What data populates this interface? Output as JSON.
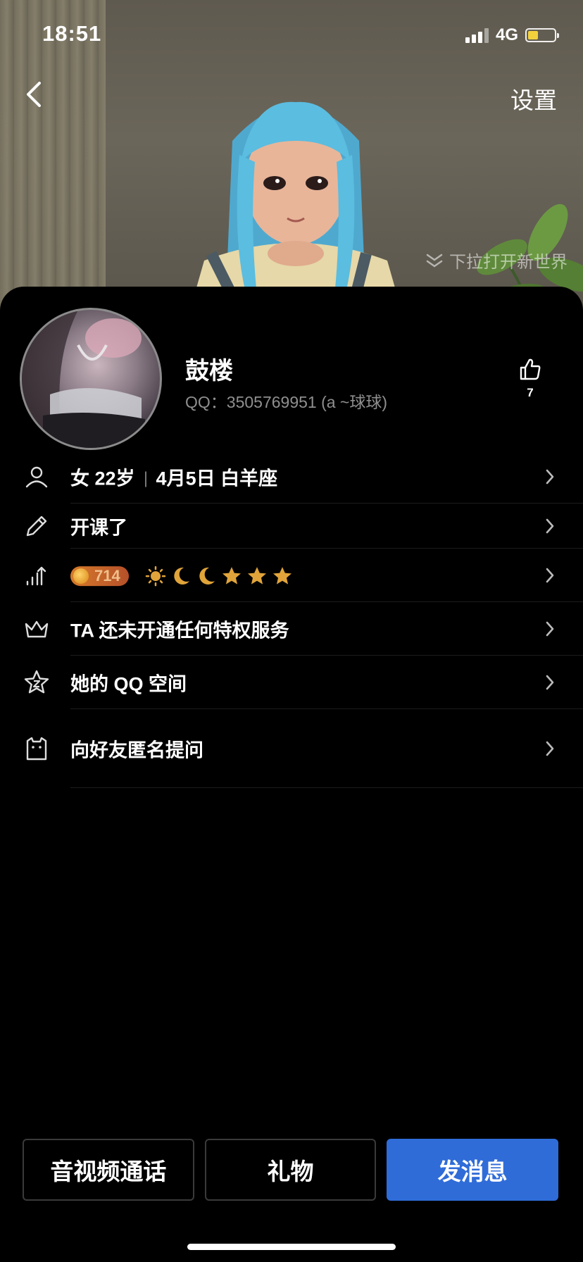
{
  "status_bar": {
    "time": "18:51",
    "network": "4G",
    "battery_level": 0.4,
    "battery_color": "#f2d23c"
  },
  "header": {
    "settings_label": "设置",
    "pull_hint": "下拉打开新世界"
  },
  "profile": {
    "name": "鼓楼",
    "qq_line": "QQ：3505769951 (a ~球球)",
    "likes": "7"
  },
  "rows": {
    "basic_info": {
      "gender_age": "女 22岁",
      "birthday": "4月5日 白羊座",
      "icon": "person-icon"
    },
    "signature": {
      "label": "开课了",
      "icon": "pencil-icon"
    },
    "level": {
      "value": "714",
      "icons": [
        "sun-icon",
        "moon-icon",
        "moon-icon",
        "star-icon",
        "star-icon",
        "star-icon"
      ],
      "icon": "level-chart-icon"
    },
    "privilege": {
      "label": "TA 还未开通任何特权服务",
      "icon": "crown-icon"
    },
    "qzone": {
      "label": "她的 QQ 空间",
      "icon": "star-outline-icon"
    },
    "anon_question": {
      "label": "向好友匿名提问",
      "icon": "cat-icon"
    }
  },
  "actions": {
    "call": "音视频通话",
    "gift": "礼物",
    "message": "发消息"
  },
  "colors": {
    "accent": "#2f6cd8",
    "background": "#000000",
    "muted_text": "#8f8f8f"
  }
}
